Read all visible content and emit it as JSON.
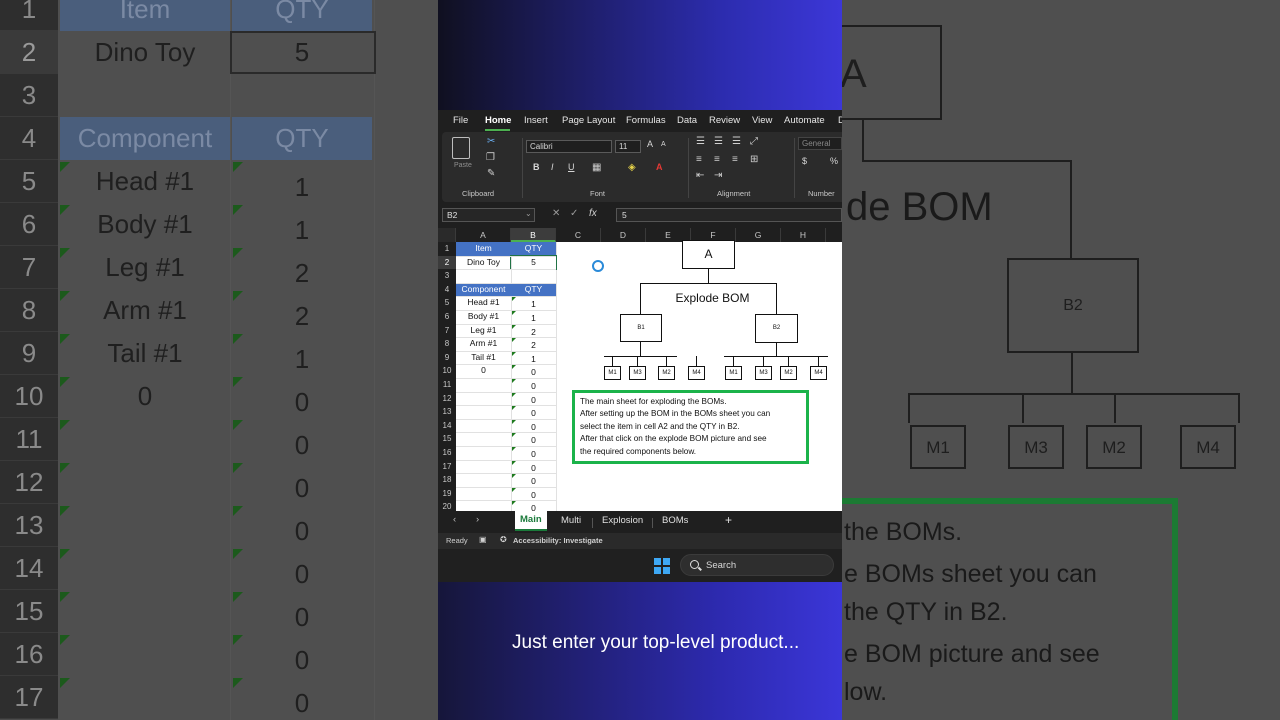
{
  "background_zoom": {
    "left": {
      "header_row": {
        "row": "1",
        "item": "Item",
        "qty": "QTY"
      },
      "rows": [
        {
          "row": "2",
          "label": "Dino Toy",
          "qty": "5"
        },
        {
          "row": "3",
          "label": "",
          "qty": ""
        },
        {
          "row": "4",
          "label": "Component",
          "qty": "QTY"
        },
        {
          "row": "5",
          "label": "Head #1",
          "qty": "1"
        },
        {
          "row": "6",
          "label": "Body #1",
          "qty": "1"
        },
        {
          "row": "7",
          "label": "Leg #1",
          "qty": "2"
        },
        {
          "row": "8",
          "label": "Arm #1",
          "qty": "2"
        },
        {
          "row": "9",
          "label": "Tail #1",
          "qty": "1"
        },
        {
          "row": "10",
          "label": "0",
          "qty": "0"
        },
        {
          "row": "11",
          "label": "",
          "qty": "0"
        },
        {
          "row": "12",
          "label": "",
          "qty": "0"
        },
        {
          "row": "13",
          "label": "",
          "qty": "0"
        },
        {
          "row": "14",
          "label": "",
          "qty": "0"
        },
        {
          "row": "15",
          "label": "",
          "qty": "0"
        },
        {
          "row": "16",
          "label": "",
          "qty": "0"
        },
        {
          "row": "17",
          "label": "",
          "qty": "0"
        }
      ]
    },
    "right": {
      "top_box": "A",
      "title": "de BOM",
      "sub_box": "B2",
      "leaves": [
        "M1",
        "M3",
        "M2",
        "M4"
      ],
      "note_lines": [
        "the BOMs.",
        "e BOMs sheet you can",
        "the QTY in B2.",
        "e BOM picture and see",
        "low."
      ]
    }
  },
  "excel": {
    "menu": [
      "File",
      "Home",
      "Insert",
      "Page Layout",
      "Formulas",
      "Data",
      "Review",
      "View",
      "Automate",
      "D"
    ],
    "ribbon": {
      "groups": [
        "Clipboard",
        "Font",
        "Alignment",
        "Number"
      ],
      "paste_label": "Paste",
      "font_name": "Calibri",
      "font_size": "11",
      "number_format": "General",
      "bold": "B",
      "italic": "I",
      "underline": "U",
      "grow_font": "A",
      "shrink_font": "A",
      "currency": "$",
      "percent": "%"
    },
    "namebox": "B2",
    "formula_value": "5",
    "fx": "fx",
    "columns": [
      "A",
      "B",
      "C",
      "D",
      "E",
      "F",
      "G",
      "H"
    ],
    "row_numbers": [
      "1",
      "2",
      "3",
      "4",
      "5",
      "6",
      "7",
      "8",
      "9",
      "10",
      "11",
      "12",
      "13",
      "14",
      "15",
      "16",
      "17",
      "18",
      "19",
      "20"
    ],
    "cells": {
      "a1": "Item",
      "b1": "QTY",
      "a2": "Dino Toy",
      "b2": "5",
      "a4": "Component",
      "b4": "QTY",
      "list": [
        {
          "a": "Head #1",
          "b": "1"
        },
        {
          "a": "Body #1",
          "b": "1"
        },
        {
          "a": "Leg #1",
          "b": "2"
        },
        {
          "a": "Arm #1",
          "b": "2"
        },
        {
          "a": "Tail #1",
          "b": "1"
        },
        {
          "a": "0",
          "b": "0"
        },
        {
          "a": "",
          "b": "0"
        },
        {
          "a": "",
          "b": "0"
        },
        {
          "a": "",
          "b": "0"
        },
        {
          "a": "",
          "b": "0"
        },
        {
          "a": "",
          "b": "0"
        },
        {
          "a": "",
          "b": "0"
        },
        {
          "a": "",
          "b": "0"
        },
        {
          "a": "",
          "b": "0"
        },
        {
          "a": "",
          "b": "0"
        },
        {
          "a": "",
          "b": "0"
        }
      ]
    },
    "diagram": {
      "top": "A",
      "title": "Explode BOM",
      "b1": "B1",
      "b2": "B2",
      "leaves_left": [
        "M1",
        "M3",
        "M2",
        "M4"
      ],
      "leaves_right": [
        "M1",
        "M3",
        "M2",
        "M4"
      ]
    },
    "note": [
      "The main sheet for exploding the BOMs.",
      "After setting up the BOM in the BOMs sheet you can",
      "select the item in cell A2 and the QTY in B2.",
      "After that click on the explode BOM picture and see",
      "the required components below."
    ],
    "tabs": [
      "Main",
      "Multi",
      "Explosion",
      "BOMs"
    ],
    "add_sheet": "+",
    "status": {
      "ready": "Ready",
      "accessibility": "Accessibility: Investigate"
    },
    "taskbar": {
      "search": "Search"
    }
  },
  "caption": "Just enter your top-level product..."
}
